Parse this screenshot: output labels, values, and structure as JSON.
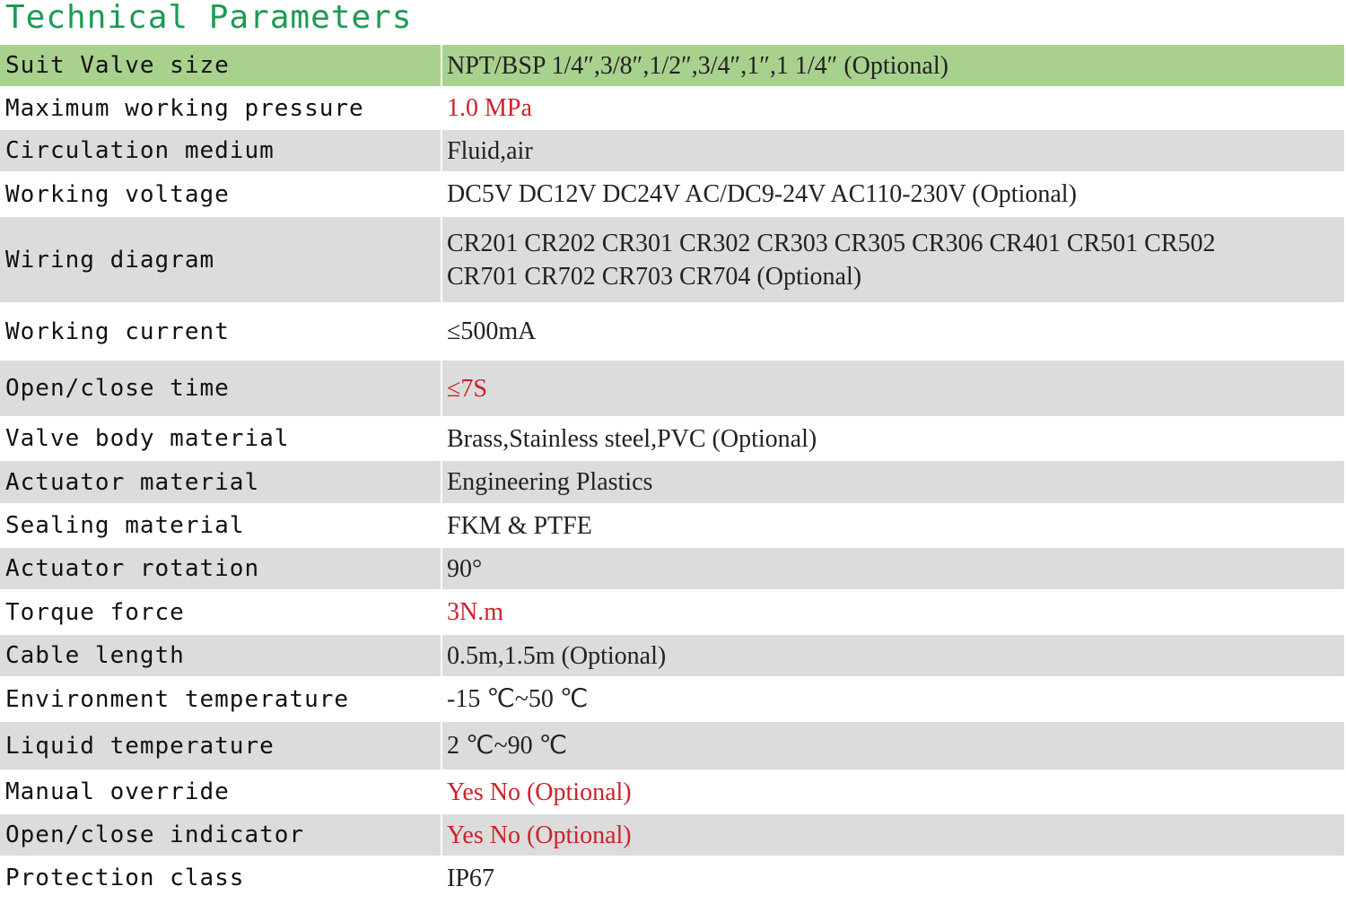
{
  "title": "Technical Parameters",
  "rows": [
    {
      "label": "Suit Valve size",
      "value": "NPT/BSP 1/4″,3/8″,1/2″,3/4″,1″,1 1/4″ (Optional)"
    },
    {
      "label": "Maximum working pressure",
      "value": "1.0 MPa"
    },
    {
      "label": "Circulation medium",
      "value": "Fluid,air"
    },
    {
      "label": "Working voltage",
      "value": "DC5V DC12V DC24V AC/DC9-24V AC110-230V (Optional)"
    },
    {
      "label": "Wiring diagram",
      "value": "CR201 CR202 CR301 CR302 CR303 CR305 CR306 CR401 CR501 CR502",
      "value2": "CR701 CR702 CR703 CR704 (Optional)"
    },
    {
      "label": "Working current",
      "value": "≤500mA"
    },
    {
      "label": "Open/close time",
      "value": "≤7S"
    },
    {
      "label": "Valve body material",
      "value": "Brass,Stainless steel,PVC (Optional)"
    },
    {
      "label": "Actuator material",
      "value": "Engineering Plastics"
    },
    {
      "label": "Sealing material",
      "value": "FKM & PTFE"
    },
    {
      "label": "Actuator rotation",
      "value": "90°"
    },
    {
      "label": "Torque force",
      "value": "3N.m"
    },
    {
      "label": "Cable length",
      "value": "0.5m,1.5m (Optional)"
    },
    {
      "label": "Environment temperature",
      "value": "-15 ℃~50 ℃"
    },
    {
      "label": "Liquid temperature",
      "value": "2 ℃~90 ℃"
    },
    {
      "label": "Manual override",
      "value": "Yes No (Optional)"
    },
    {
      "label": "Open/close indicator",
      "value": "Yes No (Optional)"
    },
    {
      "label": "Protection class",
      "value": "IP67"
    }
  ],
  "colors": {
    "title": "#1a9c52",
    "header_row": "#a9d18e",
    "stripe": "#dcdcdc",
    "highlight_text": "#d0202a"
  }
}
